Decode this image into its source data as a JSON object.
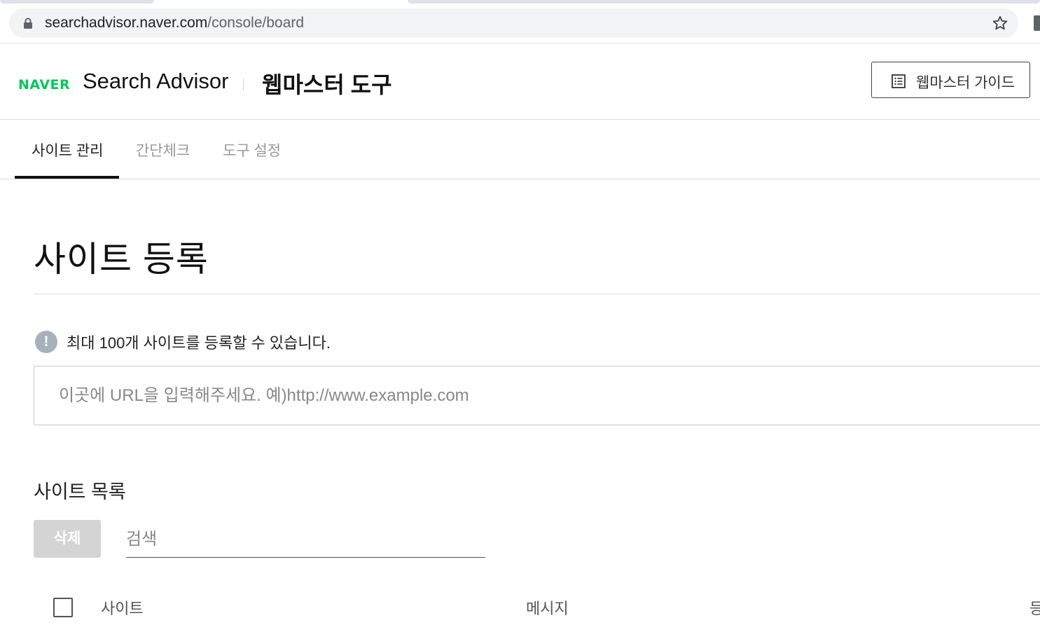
{
  "browser": {
    "url_host": "searchadvisor.naver.com",
    "url_path": "/console/board"
  },
  "header": {
    "logo_text": "NAVER",
    "service_name": "Search Advisor",
    "tool_title": "웹마스터 도구",
    "guide_button_label": "웹마스터 가이드"
  },
  "nav": {
    "tabs": [
      {
        "label": "사이트 관리",
        "active": true
      },
      {
        "label": "간단체크",
        "active": false
      },
      {
        "label": "도구 설정",
        "active": false
      }
    ]
  },
  "main": {
    "page_title": "사이트 등록",
    "notice_icon": "!",
    "notice": "최대 100개 사이트를 등록할 수 있습니다.",
    "url_input_placeholder": "이곳에 URL을 입력해주세요. 예)http://www.example.com",
    "list_title": "사이트 목록",
    "delete_button_label": "삭제",
    "search_placeholder": "검색",
    "table_columns": [
      "사이트",
      "메시지",
      "등"
    ]
  },
  "colors": {
    "brand": "#03c75a",
    "active_tab_underline": "#111111",
    "notice_icon": "#a5b1bb",
    "disabled_button": "#d4d4d4"
  },
  "icons": {
    "lock": "lock-icon",
    "star": "star-icon",
    "guide": "document-list-icon",
    "notice": "info-icon"
  }
}
